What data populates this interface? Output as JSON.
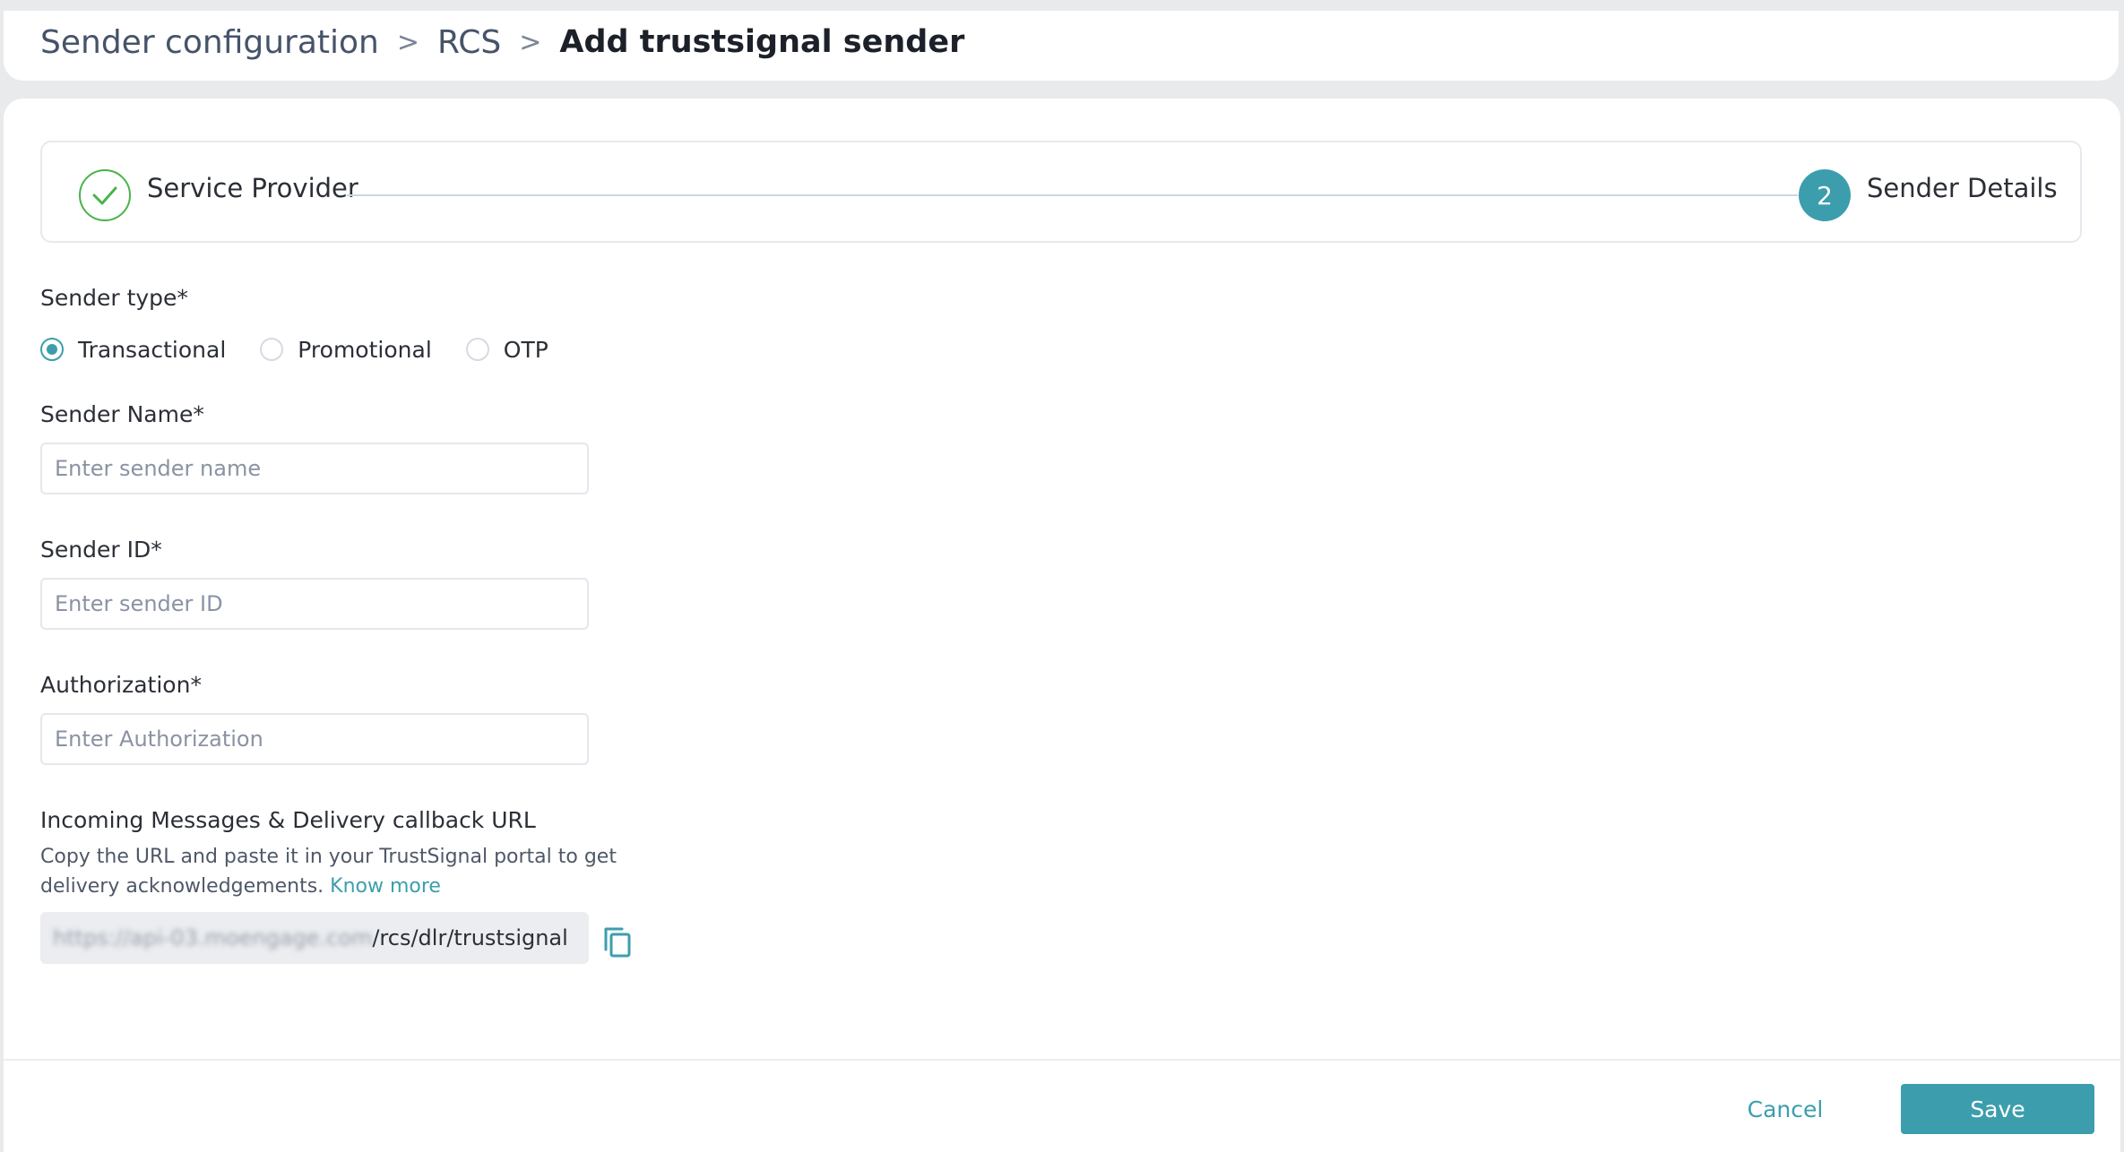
{
  "breadcrumb": {
    "items": [
      "Sender configuration",
      "RCS"
    ],
    "separator": ">",
    "current": "Add trustsignal sender"
  },
  "stepper": {
    "steps": [
      {
        "label": "Service Provider",
        "state": "completed",
        "icon": "check-icon"
      },
      {
        "label": "Sender Details",
        "state": "active",
        "number": "2"
      }
    ]
  },
  "form": {
    "sender_type": {
      "label": "Sender type*",
      "options": [
        "Transactional",
        "Promotional",
        "OTP"
      ],
      "selected": "Transactional"
    },
    "sender_name": {
      "label": "Sender Name*",
      "placeholder": "Enter sender name",
      "value": ""
    },
    "sender_id": {
      "label": "Sender ID*",
      "placeholder": "Enter sender ID",
      "value": ""
    },
    "authorization": {
      "label": "Authorization*",
      "placeholder": "Enter Authorization",
      "value": ""
    },
    "callback": {
      "label": "Incoming Messages & Delivery callback URL",
      "help_text": "Copy the URL and paste it in your TrustSignal portal to get delivery acknowledgements.",
      "link_text": "Know more",
      "url_masked": "https://api-03.moengage.com",
      "url_path": "/rcs/dlr/trustsignal",
      "copy_icon": "copy-icon"
    }
  },
  "footer": {
    "cancel_label": "Cancel",
    "save_label": "Save"
  },
  "colors": {
    "accent": "#3c9ead",
    "success": "#49b34a",
    "text": "#2b2f36",
    "muted": "#8a93a3"
  }
}
